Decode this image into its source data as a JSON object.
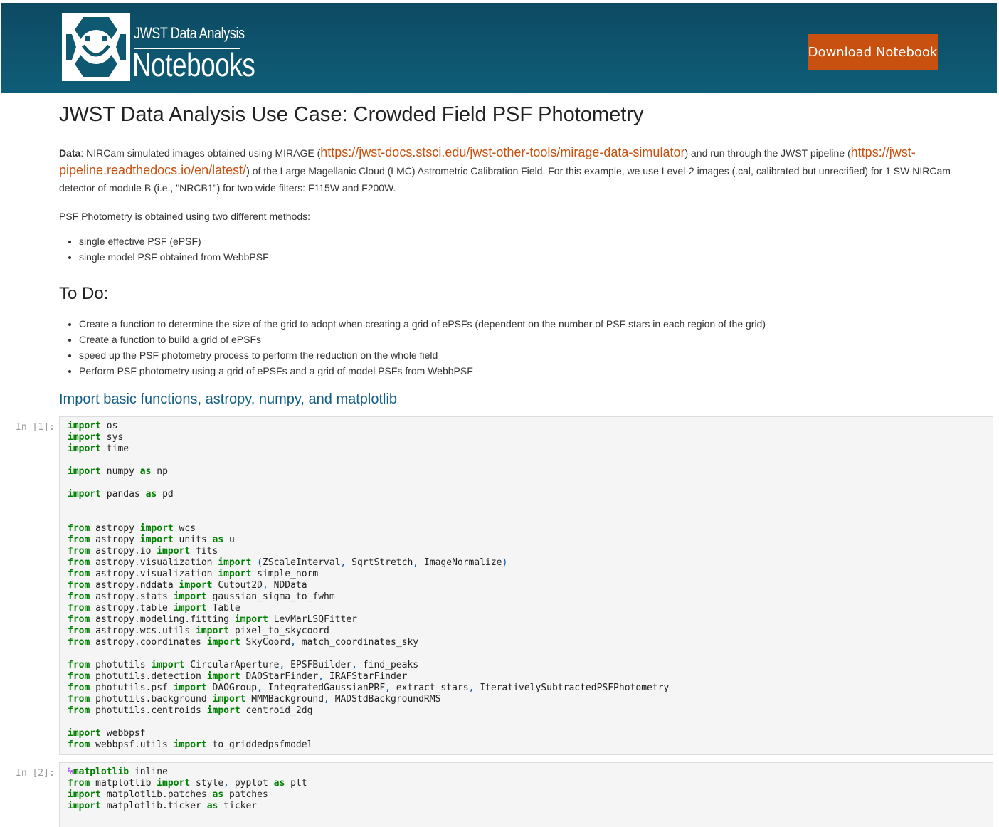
{
  "header": {
    "logo_line1": "JWST Data Analysis",
    "logo_line2": "Notebooks",
    "download_button": "Download Notebook"
  },
  "main": {
    "title": "JWST Data Analysis Use Case: Crowded Field PSF Photometry",
    "data_label": "Data",
    "data_text_1": ": NIRCam simulated images obtained using MIRAGE (",
    "data_link_1": "https://jwst-docs.stsci.edu/jwst-other-tools/mirage-data-simulator",
    "data_text_2": ") and run through the JWST pipeline (",
    "data_link_2": "https://jwst-pipeline.readthedocs.io/en/latest/",
    "data_text_3": ") of the Large Magellanic Cloud (LMC) Astrometric Calibration Field. For this example, we use Level-2 images (.cal, calibrated but unrectified) for 1 SW NIRCam detector of module B (i.e., \"NRCB1\") for two wide filters: F115W and F200W.",
    "methods_intro": "PSF Photometry is obtained using two different methods:",
    "methods": [
      "single effective PSF (ePSF)",
      "single model PSF obtained from WebbPSF"
    ],
    "todo_heading": "To Do:",
    "todo_items": [
      "Create a function to determine the size of the grid to adopt when creating a grid of ePSFs (dependent on the number of PSF stars in each region of the grid)",
      "Create a function to build a grid of ePSFs",
      "speed up the PSF photometry process to perform the reduction on the whole field",
      "Perform PSF photometry using a grid of ePSFs and a grid of model PSFs from WebbPSF"
    ],
    "section_heading": "Import basic functions, astropy, numpy, and matplotlib"
  },
  "cells": [
    {
      "prompt": "In [1]:",
      "code": "import os\nimport sys\nimport time\n\nimport numpy as np\n\nimport pandas as pd\n\n\nfrom astropy import wcs\nfrom astropy import units as u\nfrom astropy.io import fits\nfrom astropy.visualization import (ZScaleInterval, SqrtStretch, ImageNormalize)\nfrom astropy.visualization import simple_norm\nfrom astropy.nddata import Cutout2D, NDData\nfrom astropy.stats import gaussian_sigma_to_fwhm\nfrom astropy.table import Table\nfrom astropy.modeling.fitting import LevMarLSQFitter\nfrom astropy.wcs.utils import pixel_to_skycoord\nfrom astropy.coordinates import SkyCoord, match_coordinates_sky\n\nfrom photutils import CircularAperture, EPSFBuilder, find_peaks\nfrom photutils.detection import DAOStarFinder, IRAFStarFinder\nfrom photutils.psf import DAOGroup, IntegratedGaussianPRF, extract_stars, IterativelySubtractedPSFPhotometry\nfrom photutils.background import MMMBackground, MADStdBackgroundRMS\nfrom photutils.centroids import centroid_2dg\n\nimport webbpsf\nfrom webbpsf.utils import to_griddedpsfmodel"
    },
    {
      "prompt": "In [2]:",
      "code": "%matplotlib inline\nfrom matplotlib import style, pyplot as plt\nimport matplotlib.patches as patches\nimport matplotlib.ticker as ticker"
    }
  ]
}
